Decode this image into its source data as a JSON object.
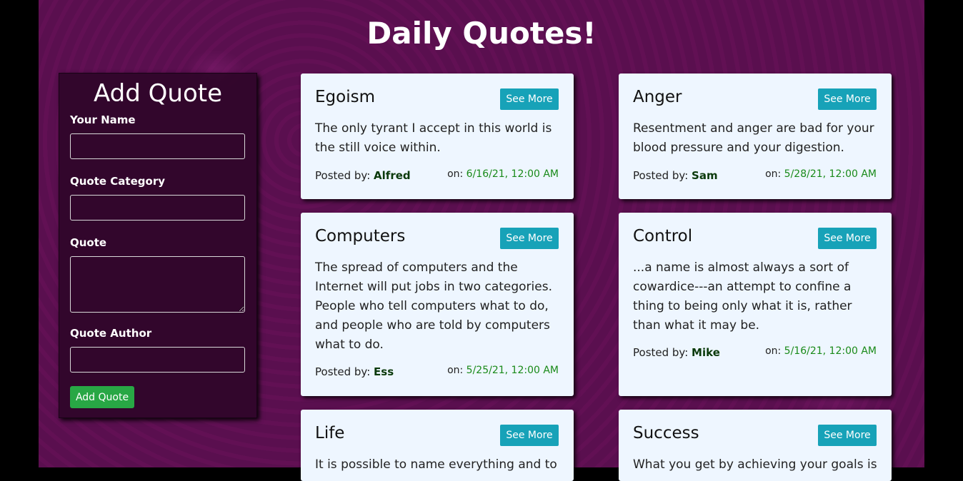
{
  "header": {
    "title": "Daily Quotes!"
  },
  "form": {
    "title": "Add Quote",
    "name_label": "Your Name",
    "category_label": "Quote Category",
    "quote_label": "Quote",
    "author_label": "Quote Author",
    "name_value": "",
    "category_value": "",
    "quote_value": "",
    "author_value": "",
    "submit_label": "Add Quote"
  },
  "cards": [
    {
      "category": "Egoism",
      "button": "See More",
      "text": "The only tyrant I accept in this world is the still voice within.",
      "posted_label": "Posted by:",
      "author": "Alfred",
      "on_label": "on:",
      "date": "6/16/21, 12:00 AM"
    },
    {
      "category": "Anger",
      "button": "See More",
      "text": "Resentment and anger are bad for your blood pressure and your digestion.",
      "posted_label": "Posted by:",
      "author": "Sam",
      "on_label": "on:",
      "date": "5/28/21, 12:00 AM"
    },
    {
      "category": "Computers",
      "button": "See More",
      "text": "The spread of computers and the Internet will put jobs in two categories. People who tell computers what to do, and people who are told by computers what to do.",
      "posted_label": "Posted by:",
      "author": "Ess",
      "on_label": "on:",
      "date": "5/25/21, 12:00 AM"
    },
    {
      "category": "Control",
      "button": "See More",
      "text": "...a name is almost always a sort of cowardice---an attempt to confine a thing to being only what it is, rather than what it may be.",
      "posted_label": "Posted by:",
      "author": "Mike",
      "on_label": "on:",
      "date": "5/16/21, 12:00 AM"
    },
    {
      "category": "Life",
      "button": "See More",
      "text": "It is possible to name everything and to",
      "posted_label": "",
      "author": "",
      "on_label": "",
      "date": ""
    },
    {
      "category": "Success",
      "button": "See More",
      "text": "What you get by achieving your goals is",
      "posted_label": "",
      "author": "",
      "on_label": "",
      "date": ""
    }
  ],
  "colors": {
    "background": "#5a0f4f",
    "card": "#eef6ff",
    "see_more": "#17a2b8",
    "add_button": "#28a745",
    "date": "#198a19"
  }
}
